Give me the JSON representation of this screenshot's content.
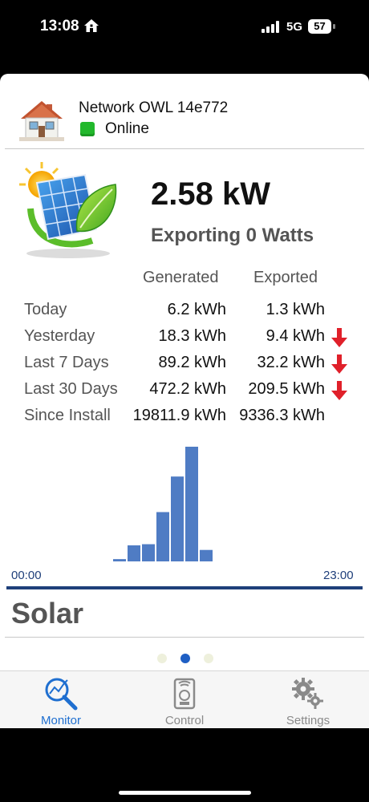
{
  "status_bar": {
    "time": "13:08",
    "network": "5G",
    "battery": "57"
  },
  "device": {
    "name": "Network OWL 14e772",
    "status": "Online"
  },
  "summary": {
    "power": "2.58 kW",
    "export_status": "Exporting 0 Watts"
  },
  "table": {
    "headers": {
      "generated": "Generated",
      "exported": "Exported"
    },
    "rows": [
      {
        "label": "Today",
        "generated": "6.2 kWh",
        "exported": "1.3 kWh",
        "arrow": false
      },
      {
        "label": "Yesterday",
        "generated": "18.3 kWh",
        "exported": "9.4 kWh",
        "arrow": true
      },
      {
        "label": "Last 7 Days",
        "generated": "89.2 kWh",
        "exported": "32.2 kWh",
        "arrow": true
      },
      {
        "label": "Last 30 Days",
        "generated": "472.2 kWh",
        "exported": "209.5 kWh",
        "arrow": true
      },
      {
        "label": "Since Install",
        "generated": "19811.9 kWh",
        "exported": "9336.3 kWh",
        "arrow": false
      }
    ]
  },
  "chart_data": {
    "type": "bar",
    "x_start": "00:00",
    "x_end": "23:00",
    "values": [
      0.02,
      0.14,
      0.15,
      0.43,
      0.74,
      1.0,
      0.1
    ],
    "bar_color": "#4f7cc4"
  },
  "section": {
    "title": "Solar"
  },
  "pager": {
    "count": 3,
    "active": 1
  },
  "tabs": [
    {
      "label": "Monitor",
      "icon": "monitor-icon",
      "active": true
    },
    {
      "label": "Control",
      "icon": "control-icon",
      "active": false
    },
    {
      "label": "Settings",
      "icon": "settings-icon",
      "active": false
    }
  ],
  "colors": {
    "accent": "#1f6fd0",
    "online": "#22b82c",
    "arrow": "#e0202a",
    "axis": "#1f3f7a"
  }
}
